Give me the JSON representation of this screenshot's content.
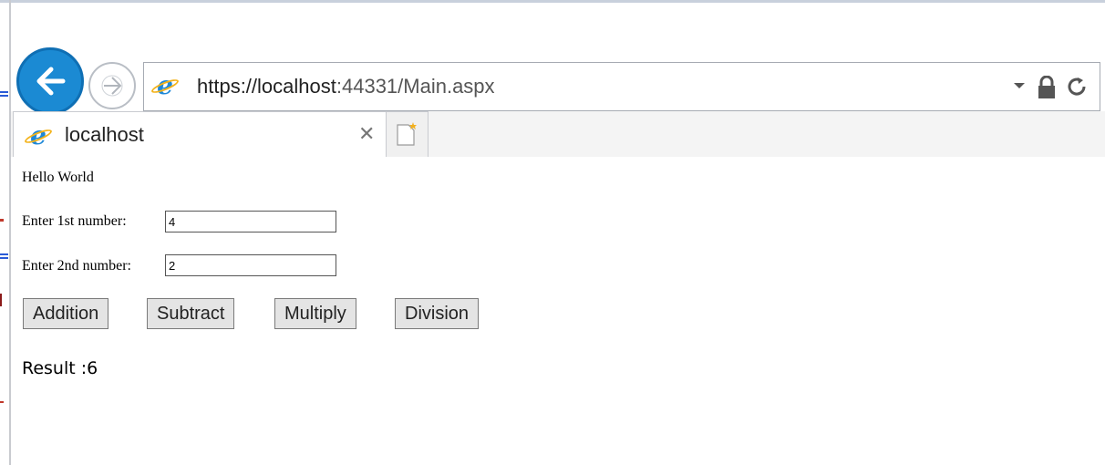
{
  "browser": {
    "address_bar": {
      "url_host": "https://localhost",
      "url_rest": ":44331/Main.aspx"
    },
    "tabs": [
      {
        "label": "localhost"
      }
    ],
    "icons": {
      "back": "back-arrow-icon",
      "forward": "forward-arrow-icon",
      "site": "ie-logo-icon",
      "lock": "lock-icon",
      "refresh": "refresh-icon",
      "dropdown": "dropdown-arrow-icon",
      "close_tab": "close-icon",
      "new_tab": "new-tab-icon"
    },
    "colors": {
      "accent": "#1b8ad3"
    }
  },
  "page": {
    "heading": "Hello World",
    "fields": [
      {
        "label": "Enter 1st number:",
        "value": "4"
      },
      {
        "label": "Enter 2nd number:",
        "value": "2"
      }
    ],
    "buttons": [
      "Addition",
      "Subtract",
      "Multiply",
      "Division"
    ],
    "result": "Result :6"
  }
}
